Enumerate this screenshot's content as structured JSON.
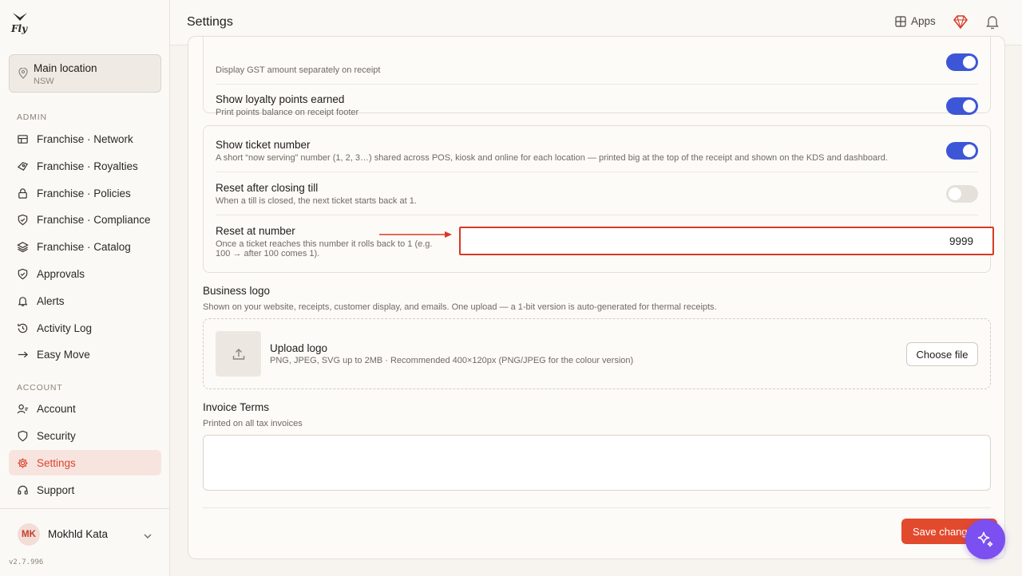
{
  "app": {
    "logo_text": "Fly",
    "version": "v2.7.996"
  },
  "location": {
    "name": "Main location",
    "region": "NSW"
  },
  "sidebar": {
    "admin_label": "ADMIN",
    "admin_items": [
      {
        "label": "Franchise · Network",
        "icon": "network-icon"
      },
      {
        "label": "Franchise · Royalties",
        "icon": "percent-icon"
      },
      {
        "label": "Franchise · Policies",
        "icon": "lock-icon"
      },
      {
        "label": "Franchise · Compliance",
        "icon": "shield-check-icon"
      },
      {
        "label": "Franchise · Catalog",
        "icon": "layers-icon"
      },
      {
        "label": "Approvals",
        "icon": "shield-check-icon"
      },
      {
        "label": "Alerts",
        "icon": "bell-icon"
      },
      {
        "label": "Activity Log",
        "icon": "clock-icon"
      },
      {
        "label": "Easy Move",
        "icon": "arrow-right-icon"
      }
    ],
    "account_label": "ACCOUNT",
    "account_items": [
      {
        "label": "Account",
        "icon": "user-icon"
      },
      {
        "label": "Security",
        "icon": "shield-icon"
      },
      {
        "label": "Settings",
        "icon": "gear-icon",
        "active": true
      },
      {
        "label": "Support",
        "icon": "headset-icon"
      }
    ]
  },
  "user": {
    "initials": "MK",
    "name": "Mokhld Kata"
  },
  "header": {
    "title": "Settings",
    "apps_label": "Apps"
  },
  "receipt": {
    "gst_desc": "Display GST amount separately on receipt",
    "gst_toggle": "on",
    "loyalty_title": "Show loyalty points earned",
    "loyalty_desc": "Print points balance on receipt footer",
    "loyalty_toggle": "on"
  },
  "ticket": {
    "show_title": "Show ticket number",
    "show_desc": "A short “now serving” number (1, 2, 3…) shared across POS, kiosk and online for each location — printed big at the top of the receipt and shown on the KDS and dashboard.",
    "show_toggle": "on",
    "reset_till_title": "Reset after closing till",
    "reset_till_desc": "When a till is closed, the next ticket starts back at 1.",
    "reset_till_toggle": "off",
    "reset_number_title": "Reset at number",
    "reset_number_desc": "Once a ticket reaches this number it rolls back to 1 (e.g. 100 → after 100 comes 1).",
    "reset_number_value": "9999"
  },
  "logo_section": {
    "title": "Business logo",
    "desc": "Shown on your website, receipts, customer display, and emails. One upload — a 1-bit version is auto-generated for thermal receipts.",
    "upload_title": "Upload logo",
    "upload_desc": "PNG, JPEG, SVG up to 2MB · Recommended 400×120px (PNG/JPEG for the colour version)",
    "choose_label": "Choose file"
  },
  "invoice": {
    "title": "Invoice Terms",
    "desc": "Printed on all tax invoices",
    "value": ""
  },
  "footer": {
    "save_label": "Save changes"
  },
  "colors": {
    "accent": "#e24a2e",
    "toggle_on": "#3d56d8",
    "highlight": "#d63a26",
    "assistant": "#7c4ff0"
  }
}
